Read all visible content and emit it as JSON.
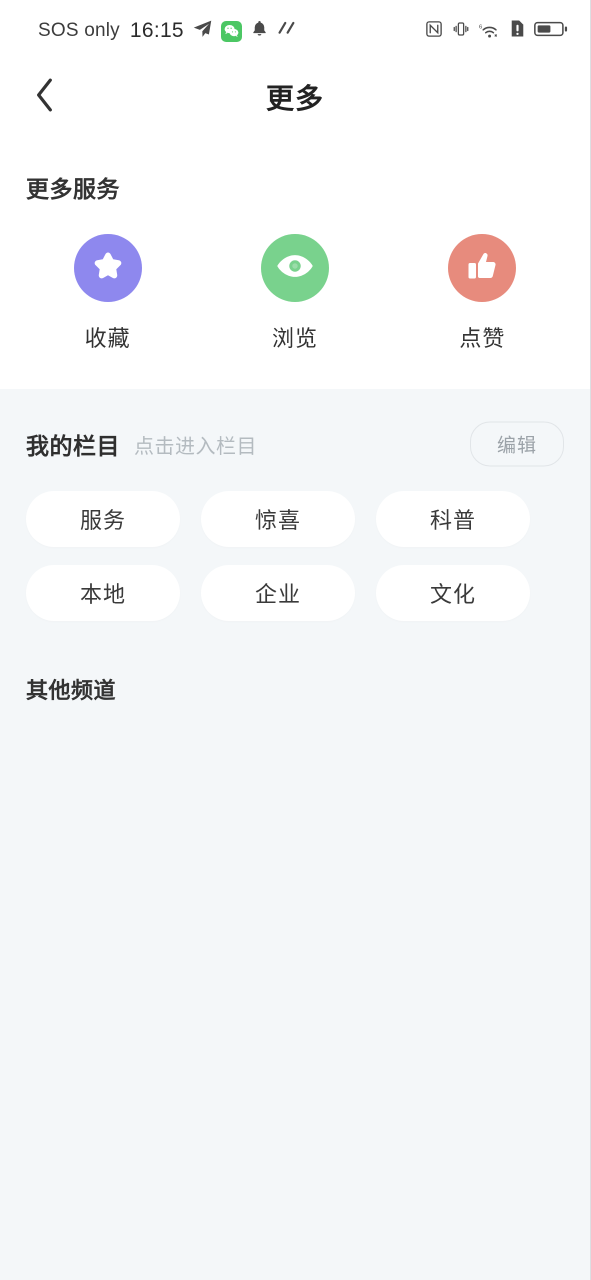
{
  "status_bar": {
    "carrier": "SOS only",
    "time": "16:15",
    "left_icons": [
      "telegram-send-icon",
      "wechat-icon",
      "bell-icon",
      "swipe-gesture-icon"
    ],
    "right_icons": [
      "nfc-icon",
      "vibrate-icon",
      "wifi-6-icon",
      "sim-alert-icon",
      "battery-icon"
    ],
    "wifi_generation": "6"
  },
  "header": {
    "back_icon": "chevron-left-icon",
    "title": "更多"
  },
  "services": {
    "section_title": "更多服务",
    "items": [
      {
        "label": "收藏",
        "icon": "star-icon",
        "color": "#8e88ee"
      },
      {
        "label": "浏览",
        "icon": "eye-icon",
        "color": "#79d28d"
      },
      {
        "label": "点赞",
        "icon": "thumbs-up-icon",
        "color": "#e78b7d"
      }
    ]
  },
  "columns": {
    "title": "我的栏目",
    "hint": "点击进入栏目",
    "edit_label": "编辑",
    "chips": [
      "服务",
      "惊喜",
      "科普",
      "本地",
      "企业",
      "文化"
    ]
  },
  "other_channels": {
    "title": "其他频道",
    "items": []
  },
  "theme": {
    "page_bg": "#f4f7f9",
    "card_bg": "#ffffff",
    "text_primary": "#333333",
    "text_muted": "#b4bbc0"
  }
}
